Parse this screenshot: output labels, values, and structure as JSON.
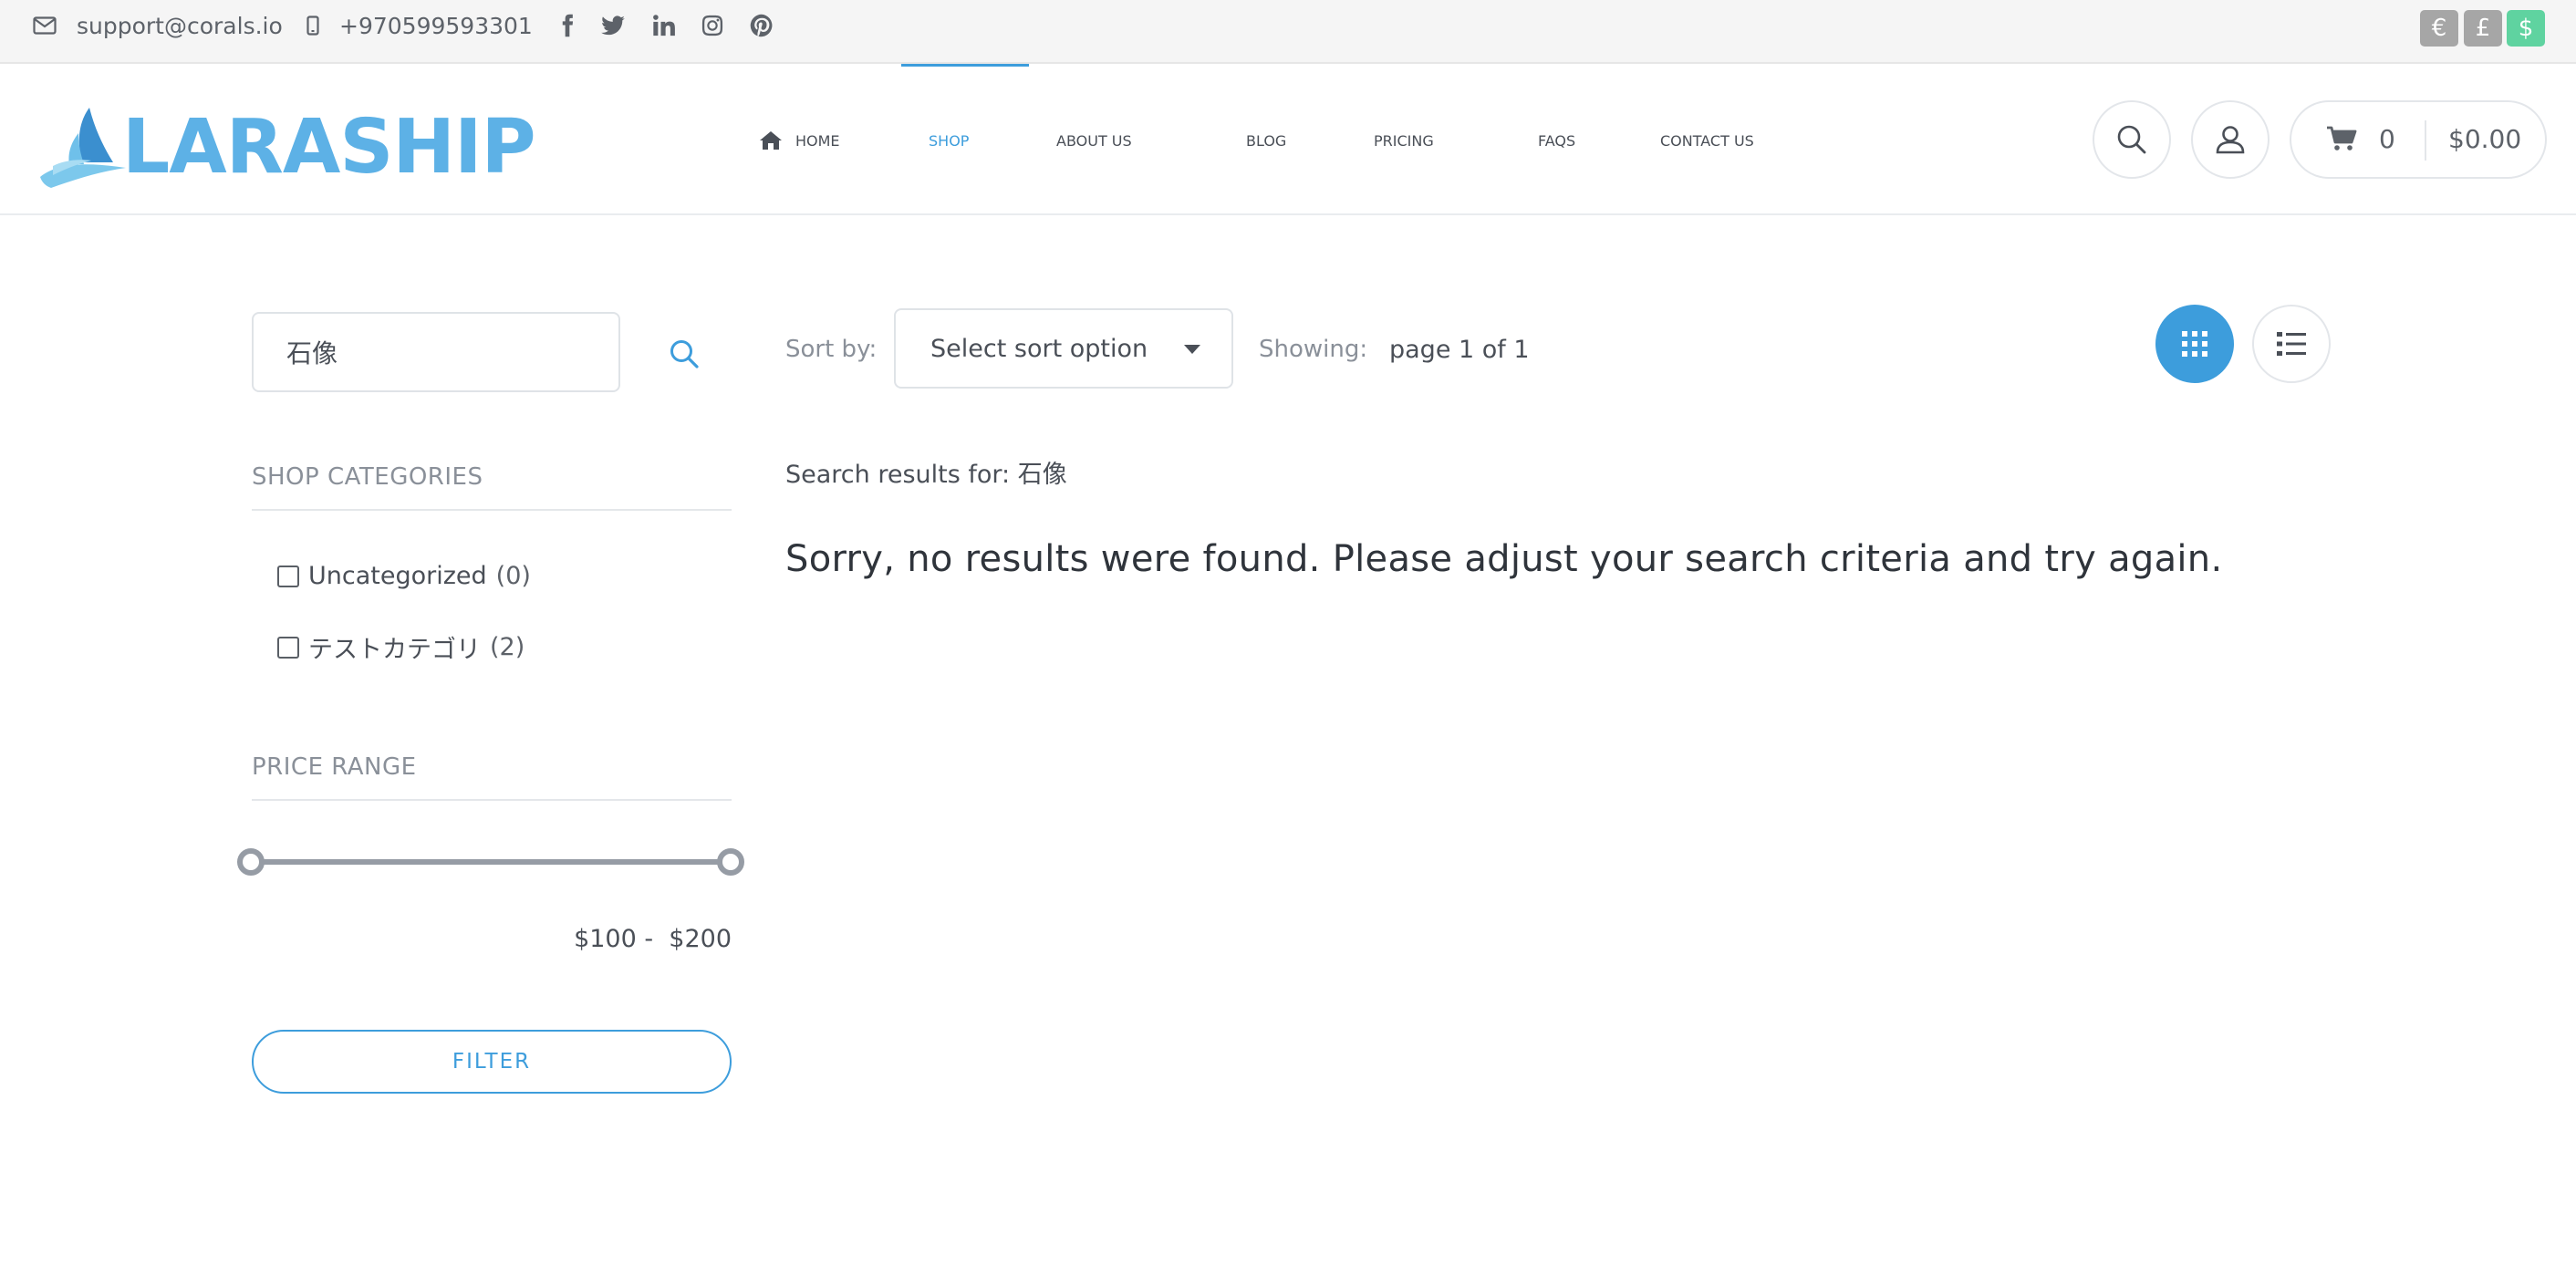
{
  "topbar": {
    "email": "support@corals.io",
    "phone": "+970599593301",
    "social": [
      "facebook-icon",
      "twitter-icon",
      "linkedin-icon",
      "instagram-icon",
      "pinterest-icon"
    ],
    "currencies": [
      {
        "symbol": "€",
        "color": "#a6a6a6"
      },
      {
        "symbol": "£",
        "color": "#a6a6a6"
      },
      {
        "symbol": "$",
        "color": "#5fd3a0"
      }
    ]
  },
  "header": {
    "logo_text": "LARASHIP",
    "nav": [
      {
        "label": "HOME",
        "icon": "home-icon"
      },
      {
        "label": "SHOP",
        "active": true
      },
      {
        "label": "ABOUT US"
      },
      {
        "label": "BLOG"
      },
      {
        "label": "PRICING"
      },
      {
        "label": "FAQS"
      },
      {
        "label": "CONTACT US"
      }
    ],
    "cart": {
      "count": "0",
      "total": "$0.00"
    }
  },
  "sidebar": {
    "search_value": "石像",
    "categories_heading": "SHOP CATEGORIES",
    "categories": [
      {
        "label": "Uncategorized",
        "count": "(0)"
      },
      {
        "label": "テストカテゴリ",
        "count": "(2)"
      }
    ],
    "price_heading": "PRICE RANGE",
    "price_min": "$100",
    "price_max": "$200",
    "price_label": "$100 -  $200",
    "filter_label": "FILTER"
  },
  "main": {
    "sort_label": "Sort by:",
    "sort_value": "Select sort option",
    "showing_label": "Showing:",
    "showing_value": "page 1 of 1",
    "results_prefix": "Search results for:",
    "results_query": "石像",
    "no_results": "Sorry, no results were found. Please adjust your search criteria and try again.",
    "accent": "#3d9ddc"
  }
}
